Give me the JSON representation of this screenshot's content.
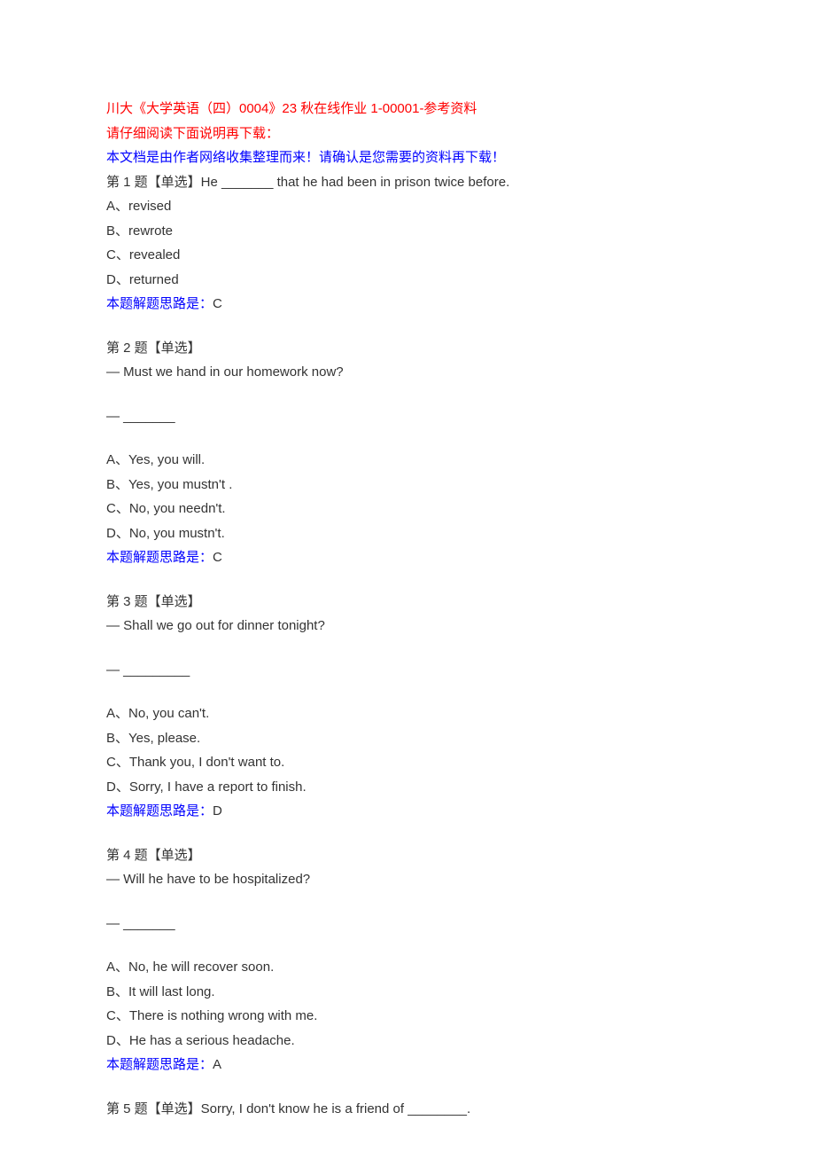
{
  "title": "川大《大学英语（四）0004》23 秋在线作业 1-00001-参考资料",
  "note1": "请仔细阅读下面说明再下载：",
  "note2": "本文档是由作者网络收集整理而来！请确认是您需要的资料再下载！",
  "answer_prefix": "本题解题思路是：",
  "questions": [
    {
      "header": "第 1 题【单选】He _______ that he had been in prison twice before.",
      "lines": [],
      "options": [
        "A、revised",
        "B、rewrote",
        "C、revealed",
        "D、returned"
      ],
      "answer": "C"
    },
    {
      "header": "第 2 题【单选】",
      "lines": [
        "— Must we hand in our homework now?",
        "",
        "— _______"
      ],
      "options": [
        "A、Yes, you will.",
        "B、Yes, you mustn't .",
        "C、No, you needn't.",
        "D、No, you mustn't."
      ],
      "answer": "C"
    },
    {
      "header": "第 3 题【单选】",
      "lines": [
        "— Shall we go out for dinner tonight?",
        "",
        "— _________"
      ],
      "options": [
        "A、No, you can't.",
        "B、Yes, please.",
        "C、Thank you, I don't want to.",
        "D、Sorry, I have a report to finish."
      ],
      "answer": "D"
    },
    {
      "header": "第 4 题【单选】",
      "lines": [
        "— Will he have to be hospitalized?",
        "",
        "— _______"
      ],
      "options": [
        "A、No, he will recover soon.",
        "B、It will last long.",
        "C、There is nothing wrong with me.",
        "D、He has a serious headache."
      ],
      "answer": "A"
    },
    {
      "header": "第 5 题【单选】Sorry, I don't know he is a friend of ________.",
      "lines": [],
      "options": [],
      "answer": null
    }
  ]
}
